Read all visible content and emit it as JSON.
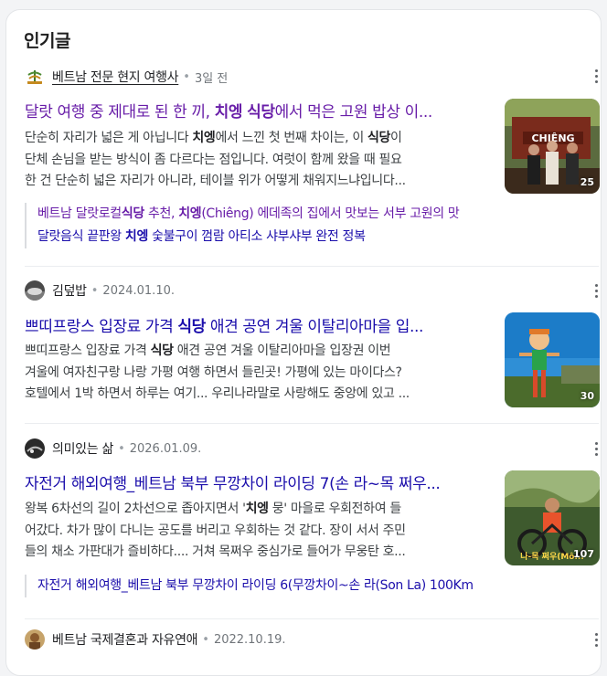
{
  "section": {
    "title": "인기글"
  },
  "posts": [
    {
      "source": "베트남 전문 현지 여행사",
      "date": "3일 전",
      "title": {
        "pre": "달랏 여행 중 제대로 된 한 끼, ",
        "kw1": "치엥",
        "mid": " ",
        "kw2": "식당",
        "post": "에서 먹은 고원 밥상 이..."
      },
      "snippet": [
        {
          "a": "단순히 자리가 넓은 게 아닙니다 ",
          "k1": "치엥",
          "b": "에서 느낀 첫 번째 차이는, 이 ",
          "k2": "식당",
          "c": "이"
        },
        {
          "a": "단체 손님을 받는 방식이 좀 다르다는 점입니다. 여럿이 함께 왔을 때 필요"
        },
        {
          "a": "한 건 단순히 넓은 자리가 아니라, 테이블 위가 어떻게 채워지느냐입니다..."
        }
      ],
      "thumb_count": "25",
      "thumb_sign": "CHIÊNG",
      "sublinks": [
        {
          "a": "베트남 달랏로컬",
          "k1": "식당",
          "b": " 추천, ",
          "k2": "치엥",
          "c": "(Chiêng) 에데족의 집에서 맛보는 서부 고원의 맛"
        },
        {
          "a": "달랏음식 끝판왕 ",
          "k1": "치엥",
          "b": " 숯불구이 껌람 아티소 샤부샤부 완전 정복"
        }
      ]
    },
    {
      "source": "김덮밥",
      "date": "2024.01.10.",
      "title": {
        "pre": "쁘띠프랑스 입장료 가격 ",
        "kw1": "식당",
        "post": " 애견 공연 겨울 이탈리아마을 입..."
      },
      "snippet": [
        {
          "a": "쁘띠프랑스 입장료 가격 ",
          "k1": "식당",
          "b": " 애견 공연 겨울 이탈리아마을 입장권 이번"
        },
        {
          "a": "겨울에 여자친구랑 나랑 가평 여행 하면서 들린곳! 가평에 있는 마이다스?"
        },
        {
          "a": "호텔에서 1박 하면서 하루는 여기... 우리나라말로 사랑해도 중앙에 있고 ..."
        }
      ],
      "thumb_count": "30"
    },
    {
      "source": "의미있는 삶",
      "date": "2026.01.09.",
      "title": {
        "pre": "자전거 해외여행_베트남 북부 무깡차이 라이딩 7(손 라~목 쩌우..."
      },
      "snippet": [
        {
          "a": "왕복 6차선의 길이 2차선으로 좁아지면서 '",
          "k1": "치엥",
          "b": " 뭉' 마을로 우회전하여 들"
        },
        {
          "a": "어갔다. 차가 많이 다니는 공도를 버리고 우회하는 것 같다. 장이 서서 주민"
        },
        {
          "a": "들의 채소 가판대가 즐비하다.... 거쳐 목쩌우 중심가로 들어가 무웅탄 호..."
        }
      ],
      "thumb_count": "107",
      "thumb_caption": "나-목 쩌우(Mô...",
      "sublinks": [
        {
          "a": "자전거 해외여행_베트남 북부 무깡차이 라이딩 6(무깡차이~손 라(Son La) 100Km"
        }
      ]
    },
    {
      "source": "베트남 국제결혼과 자유연애",
      "date": "2022.10.19."
    }
  ],
  "icons": {
    "more": "more-vert-icon"
  },
  "colors": {
    "visited": "#681da8",
    "link": "#1a0dab",
    "text": "#3c4043"
  }
}
